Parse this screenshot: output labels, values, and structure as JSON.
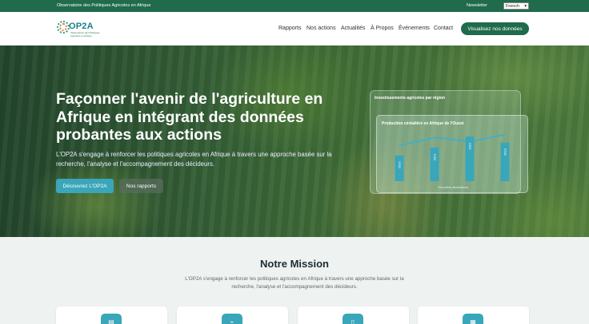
{
  "topbar": {
    "org_name": "Observatoire des Politiques Agricoles en Afrique",
    "newsletter": "Newsletter",
    "language": "French"
  },
  "logo": {
    "wordmark": "OP2A",
    "tagline_1": "Observatoire des Politiques",
    "tagline_2": "Agricoles en Afrique"
  },
  "nav": {
    "items": [
      "Rapports",
      "Nos actions",
      "Actualités",
      "À Propos",
      "Événements",
      "Contact"
    ],
    "cta": "Visualisez nos données"
  },
  "hero": {
    "title": "Façonner l'avenir de l'agriculture en Afrique en intégrant des données probantes aux actions",
    "text": "L'OP2A s'engage à renforcer les politiques agricoles en Afrique à travers une approche basée sur la recherche, l'analyse et l'accompagnement des décideurs.",
    "primary_button": "Découvrez L'OP2A",
    "secondary_button": "Nos rapports"
  },
  "cards": {
    "back_title": "Investissements agricoles par région",
    "front_title": "Production céréalière en Afrique de l'Ouest",
    "note": "*Données illustratives"
  },
  "chart_data": {
    "type": "bar",
    "title": "Production céréalière en Afrique de l'Ouest",
    "categories": [
      "2020",
      "2021",
      "2022",
      "2023"
    ],
    "values": [
      52,
      68,
      90,
      78
    ],
    "trend": [
      72,
      88,
      80,
      94
    ],
    "ylim": [
      0,
      100
    ],
    "bar_color": "#3aa6b9",
    "line_color": "#38b0d0"
  },
  "mission": {
    "title": "Notre Mission",
    "text": "L'OP2A s'engage à renforcer les politiques agricoles en Afrique à travers une approche basée sur la recherche, l'analyse et l'accompagnement des décideurs."
  },
  "feature_icons": [
    "clipboard-icon",
    "chart-icon",
    "document-icon",
    "building-icon"
  ],
  "colors": {
    "brand": "#1f6b4c",
    "accent": "#3aa6b9"
  }
}
